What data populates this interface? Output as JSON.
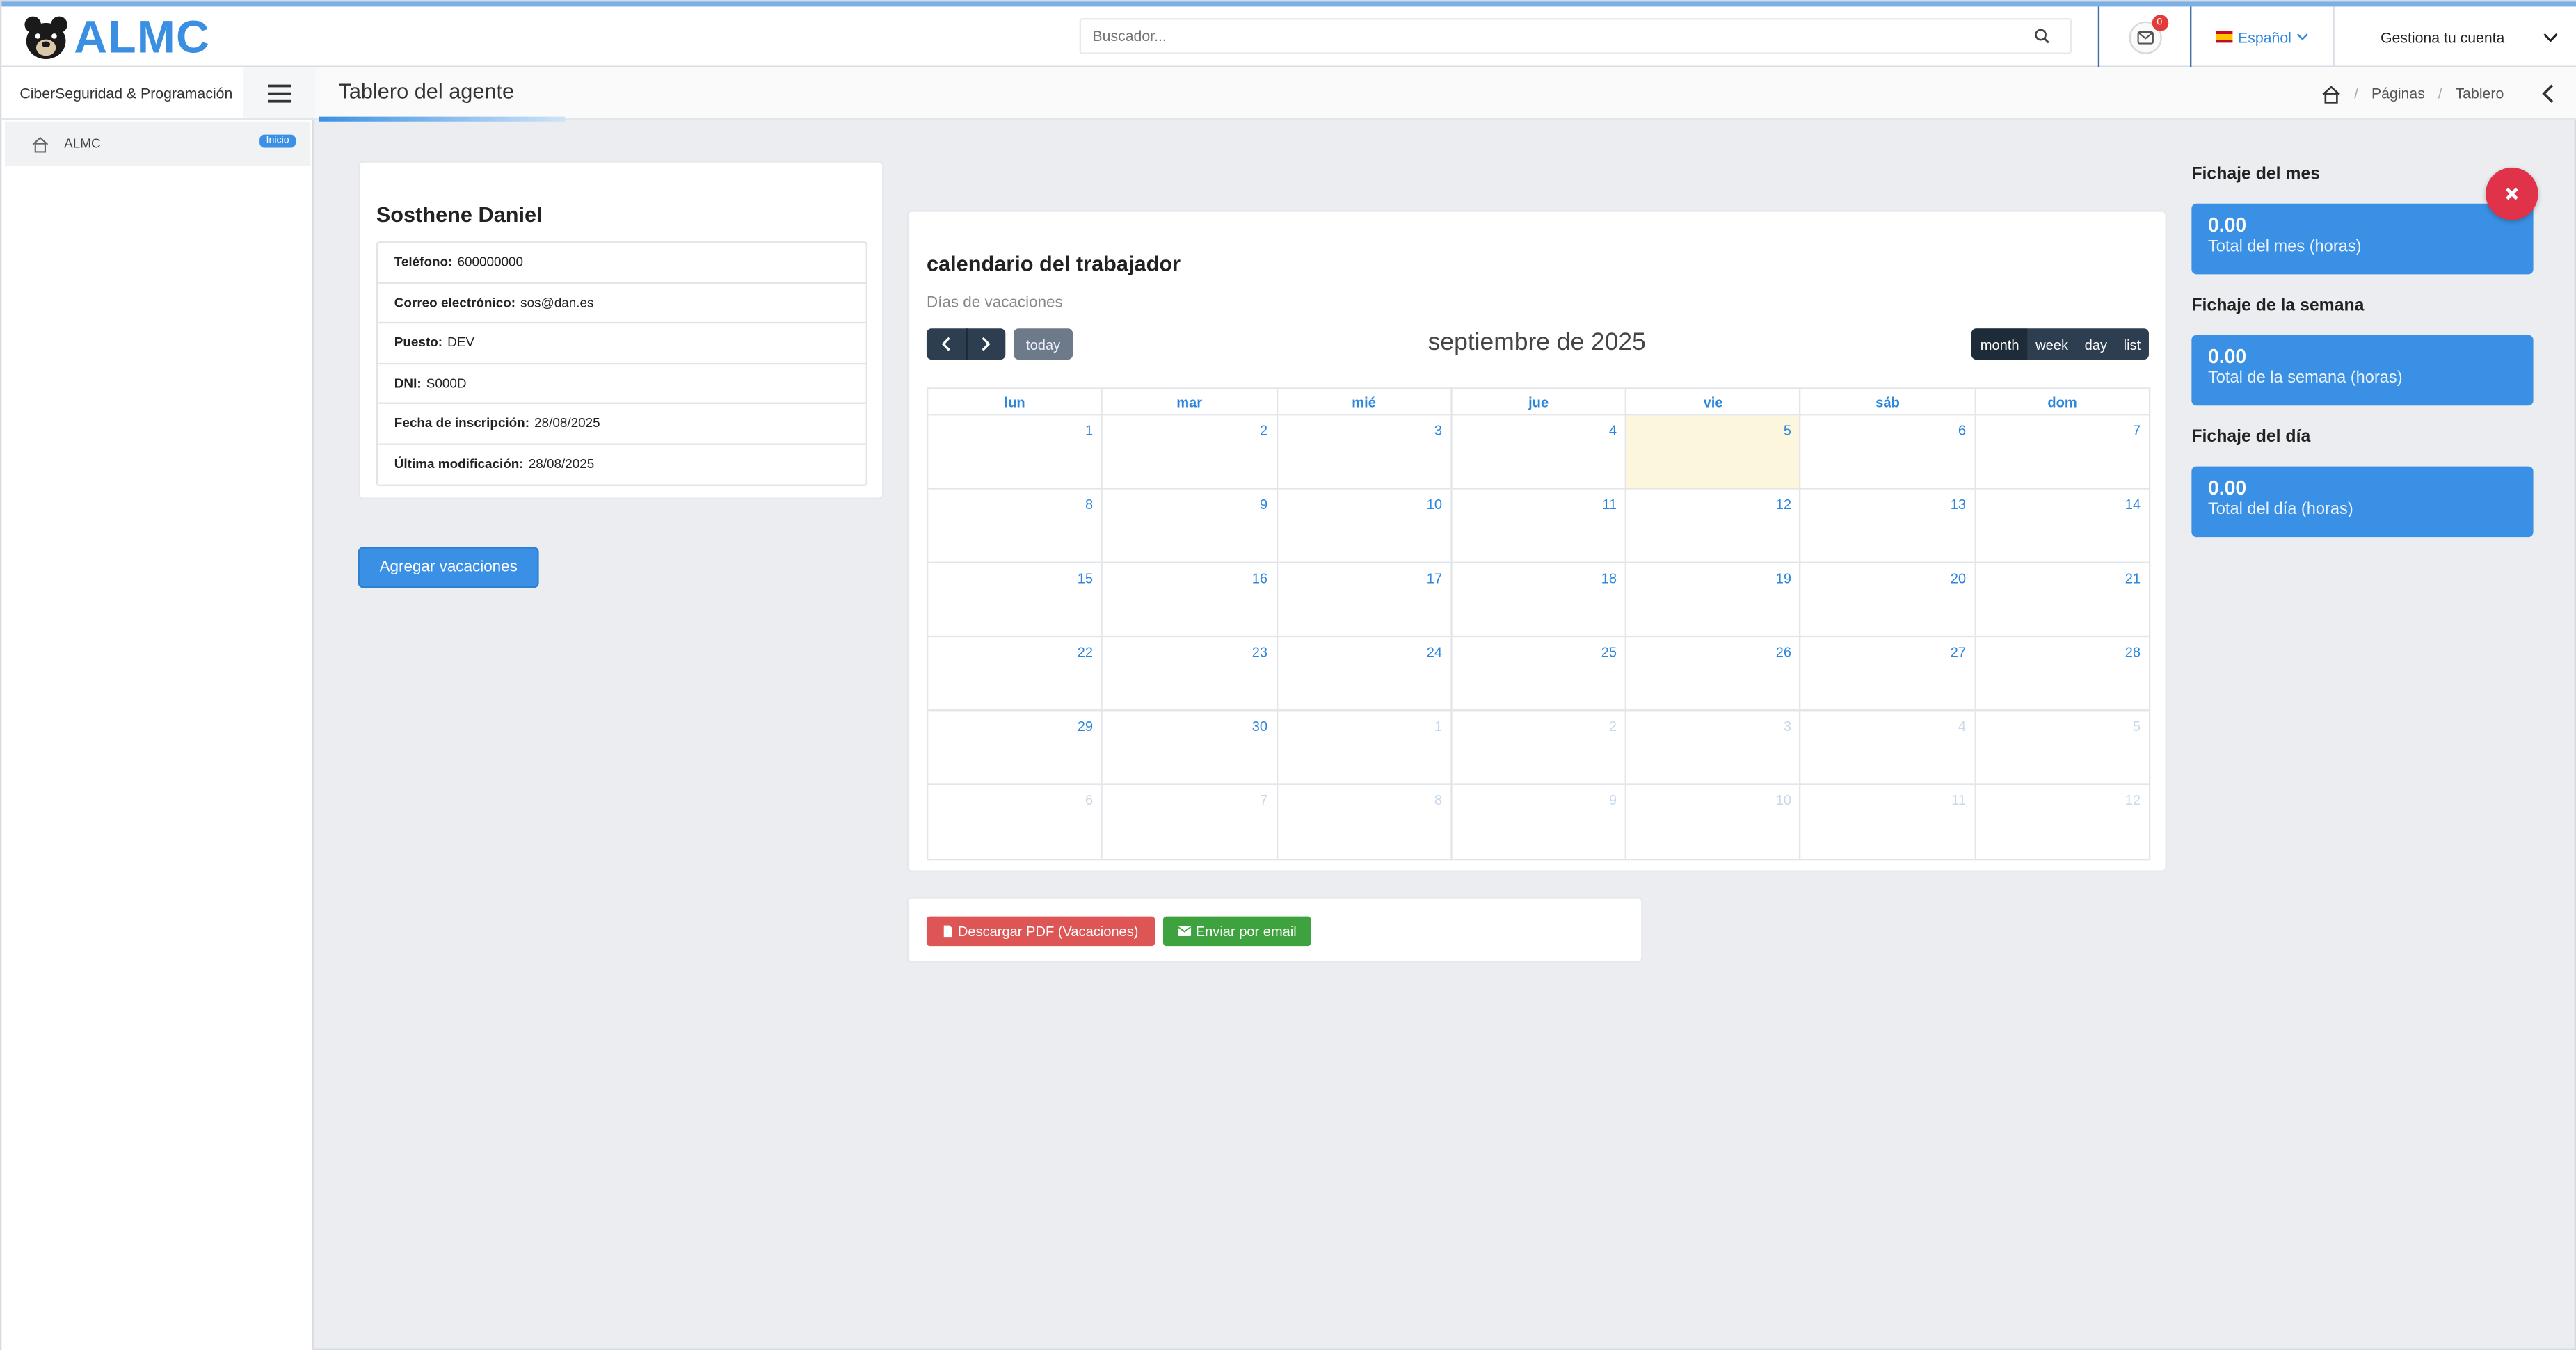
{
  "header": {
    "logo_text": "ALMC",
    "search_placeholder": "Buscador...",
    "mail_count": "0",
    "language": "Español",
    "account_label": "Gestiona tu cuenta"
  },
  "sidebar": {
    "org_title": "CiberSeguridad & Programación",
    "items": [
      {
        "label": "ALMC",
        "badge": "Inicio"
      }
    ]
  },
  "page": {
    "title": "Tablero del agente",
    "breadcrumb": [
      "Páginas",
      "Tablero"
    ]
  },
  "agent": {
    "name": "Sosthene Daniel",
    "fields": [
      {
        "label": "Teléfono:",
        "value": "600000000"
      },
      {
        "label": "Correo electrónico:",
        "value": "sos@dan.es"
      },
      {
        "label": "Puesto:",
        "value": "DEV"
      },
      {
        "label": "DNI:",
        "value": "S000D"
      },
      {
        "label": "Fecha de inscripción:",
        "value": "28/08/2025"
      },
      {
        "label": "Última modificación:",
        "value": "28/08/2025"
      }
    ],
    "add_vacation_button": "Agregar vacaciones"
  },
  "calendar": {
    "title": "calendario del trabajador",
    "subtitle": "Días de vacaciones",
    "today_button": "today",
    "month_title": "septiembre de 2025",
    "views": [
      "month",
      "week",
      "day",
      "list"
    ],
    "active_view": "month",
    "weekdays": [
      "lun",
      "mar",
      "mié",
      "jue",
      "vie",
      "sáb",
      "dom"
    ],
    "today_date": "5",
    "weeks": [
      [
        {
          "d": "1"
        },
        {
          "d": "2"
        },
        {
          "d": "3"
        },
        {
          "d": "4"
        },
        {
          "d": "5",
          "today": true
        },
        {
          "d": "6"
        },
        {
          "d": "7"
        }
      ],
      [
        {
          "d": "8"
        },
        {
          "d": "9"
        },
        {
          "d": "10"
        },
        {
          "d": "11"
        },
        {
          "d": "12"
        },
        {
          "d": "13"
        },
        {
          "d": "14"
        }
      ],
      [
        {
          "d": "15"
        },
        {
          "d": "16"
        },
        {
          "d": "17"
        },
        {
          "d": "18"
        },
        {
          "d": "19"
        },
        {
          "d": "20"
        },
        {
          "d": "21"
        }
      ],
      [
        {
          "d": "22"
        },
        {
          "d": "23"
        },
        {
          "d": "24"
        },
        {
          "d": "25"
        },
        {
          "d": "26"
        },
        {
          "d": "27"
        },
        {
          "d": "28"
        }
      ],
      [
        {
          "d": "29"
        },
        {
          "d": "30"
        },
        {
          "d": "1",
          "other": true
        },
        {
          "d": "2",
          "other": true
        },
        {
          "d": "3",
          "other": true
        },
        {
          "d": "4",
          "other": true
        },
        {
          "d": "5",
          "other": true
        }
      ],
      [
        {
          "d": "6",
          "other": true
        },
        {
          "d": "7",
          "other": true
        },
        {
          "d": "8",
          "other": true
        },
        {
          "d": "9",
          "other": true
        },
        {
          "d": "10",
          "other": true
        },
        {
          "d": "11",
          "other": true
        },
        {
          "d": "12",
          "other": true
        }
      ]
    ]
  },
  "actions": {
    "pdf_button": "Descargar PDF (Vacaciones)",
    "email_button": "Enviar por email"
  },
  "fichaje": [
    {
      "label": "Fichaje del mes",
      "value": "0.00",
      "caption": "Total del mes (horas)"
    },
    {
      "label": "Fichaje de la semana",
      "value": "0.00",
      "caption": "Total de la semana (horas)"
    },
    {
      "label": "Fichaje del día",
      "value": "0.00",
      "caption": "Total del día (horas)"
    }
  ],
  "colors": {
    "primary": "#3a90e4",
    "danger": "#dd5555",
    "success": "#3ea33e",
    "dark": "#2c3e50",
    "today_bg": "#fcf6dc",
    "close": "#e0334a"
  },
  "icons": {
    "search": "search-icon",
    "mail": "mail-icon",
    "menu": "hamburger-icon",
    "home": "home-icon",
    "close": "close-icon"
  }
}
